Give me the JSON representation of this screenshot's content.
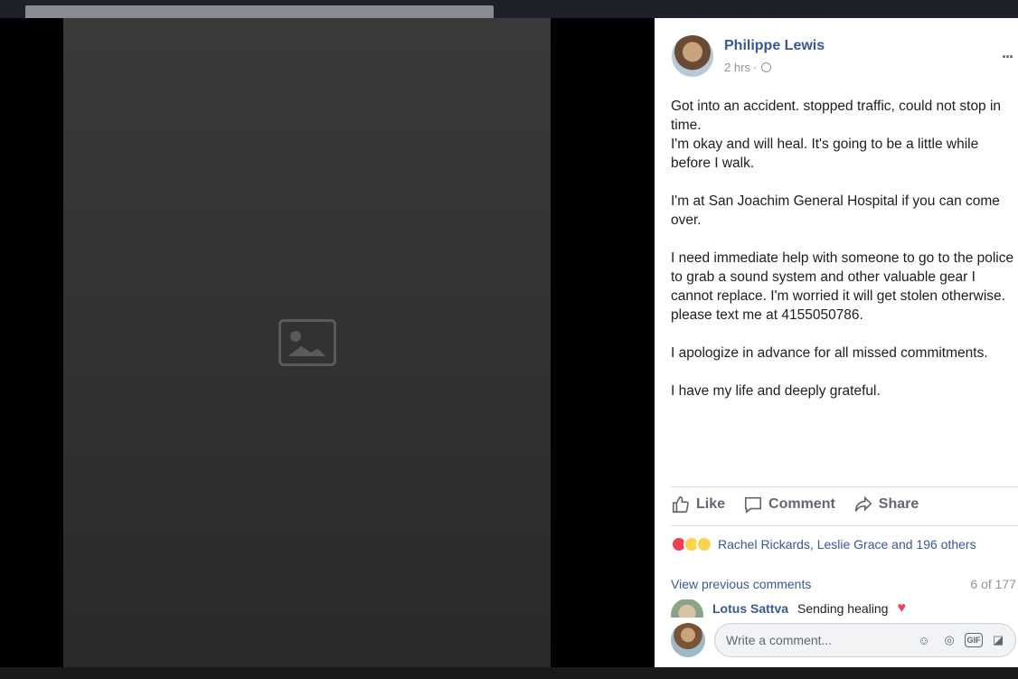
{
  "post": {
    "author": "Philippe Lewis",
    "time": "2 hrs",
    "separator": "·",
    "more": "...",
    "paragraphs": [
      "Got into an accident. stopped traffic, could not stop in time.\nI'm okay and will heal. It's going to be a little while before I walk.",
      "I'm at San Joachim General Hospital if you can come over.",
      "I need immediate help with someone to go to the police to grab a sound system and other valuable gear I cannot replace. I'm worried it will get stolen otherwise. please text me at 4155050786.",
      "I apologize in advance for all missed commitments.",
      "I have my life and deeply grateful."
    ]
  },
  "actions": {
    "like": "Like",
    "comment": "Comment",
    "share": "Share"
  },
  "reactions": {
    "icons": [
      "love",
      "wow",
      "sad"
    ],
    "summary": "Rachel Rickards, Leslie Grace and 196 others"
  },
  "comments": {
    "view_previous": "View previous comments",
    "count": "6 of 177",
    "latest": {
      "author": "Lotus Sattva",
      "text": "Sending healing",
      "emoji": "♥"
    }
  },
  "composer": {
    "placeholder": "Write a comment..."
  },
  "colors": {
    "link": "#385898",
    "muted": "#90949c",
    "love": "#f33e58"
  }
}
